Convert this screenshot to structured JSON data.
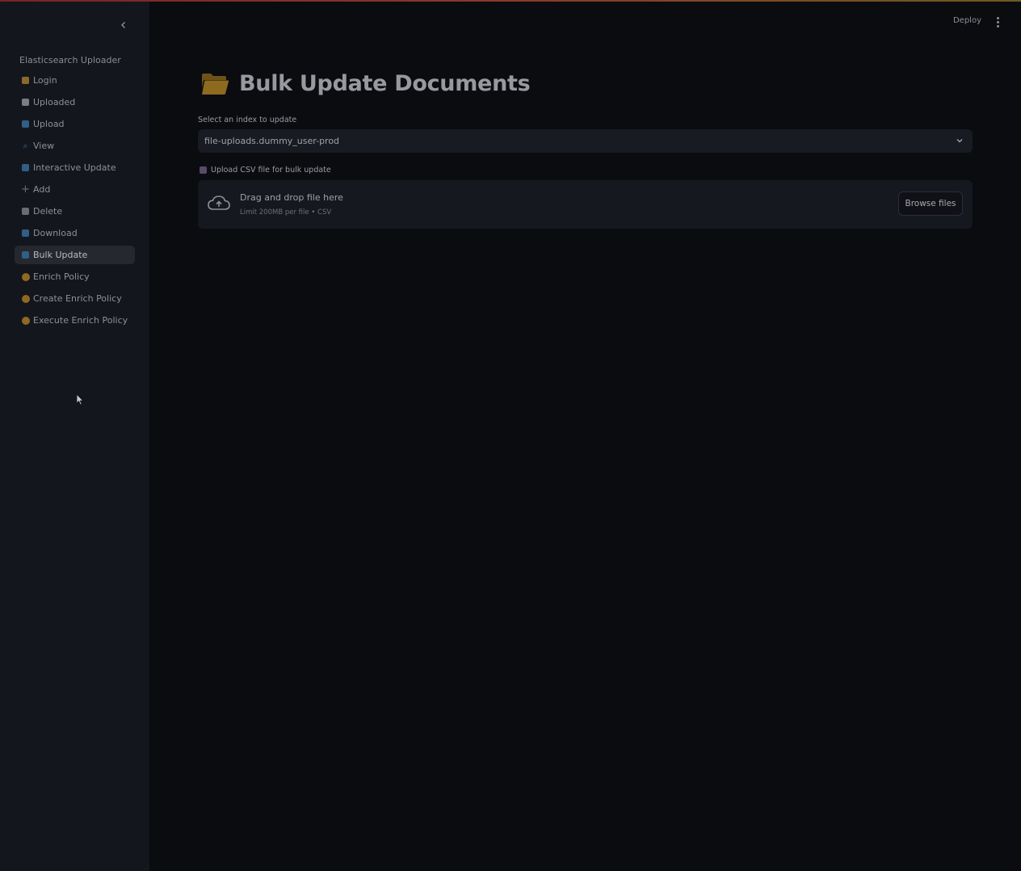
{
  "sidebar": {
    "title": "Elasticsearch Uploader",
    "items": [
      {
        "label": "Login",
        "icon": "lock-icon",
        "color": "#8a6a2a",
        "active": false
      },
      {
        "label": "Uploaded",
        "icon": "document-icon",
        "color": "#7a7d83",
        "active": false
      },
      {
        "label": "Upload",
        "icon": "upload-icon",
        "color": "#2f5f86",
        "active": false
      },
      {
        "label": "View",
        "icon": "magnifier-icon",
        "color": "#3b6a94",
        "active": false
      },
      {
        "label": "Interactive Update",
        "icon": "refresh-icon",
        "color": "#2f5f86",
        "active": false
      },
      {
        "label": "Add",
        "icon": "plus-icon",
        "color": "#6a6d73",
        "active": false
      },
      {
        "label": "Delete",
        "icon": "trash-icon",
        "color": "#6a6d73",
        "active": false
      },
      {
        "label": "Download",
        "icon": "download-icon",
        "color": "#2f5f86",
        "active": false
      },
      {
        "label": "Bulk Update",
        "icon": "refresh-icon",
        "color": "#2f5f86",
        "active": true
      },
      {
        "label": "Enrich Policy",
        "icon": "circle-icon",
        "color": "#8e6a1f",
        "active": false
      },
      {
        "label": "Create Enrich Policy",
        "icon": "circle-icon",
        "color": "#8e6a1f",
        "active": false
      },
      {
        "label": "Execute Enrich Policy",
        "icon": "circle-icon",
        "color": "#8e6a1f",
        "active": false
      }
    ]
  },
  "header": {
    "deploy_label": "Deploy"
  },
  "main": {
    "title": "Bulk Update Documents",
    "title_icon": "folder-icon",
    "index_select": {
      "label": "Select an index to update",
      "value": "file-uploads.dummy_user-prod"
    },
    "uploader": {
      "label": "Upload CSV file for bulk update",
      "drop_text": "Drag and drop file here",
      "limit_text": "Limit 200MB per file • CSV",
      "browse_label": "Browse files"
    }
  },
  "colors": {
    "background": "#0a0c10",
    "sidebar": "#14161e",
    "accent_folder": "#8e6a1f"
  }
}
